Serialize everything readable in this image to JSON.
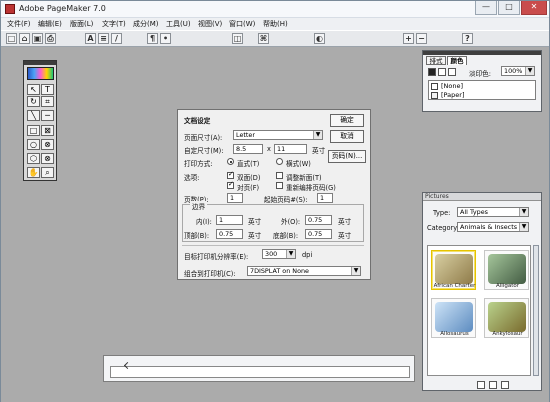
{
  "window": {
    "title": "Adobe PageMaker 7.0",
    "controls": [
      "—",
      "□",
      "✕"
    ]
  },
  "menubar": [
    "文件(F)",
    "编辑(E)",
    "版面(L)",
    "文字(T)",
    "成分(M)",
    "工具(U)",
    "视图(V)",
    "窗口(W)",
    "帮助(H)"
  ],
  "toolbar": {
    "items": [
      "new-document-icon",
      "open-folder-icon",
      "save-icon",
      "print-icon",
      "text-tool-icon",
      "align-left-icon",
      "italic-icon",
      "paragraph-icon",
      "bullet-list-icon",
      "image-frame-icon",
      "link-icon",
      "color-icon",
      "zoom-in-icon",
      "zoom-out-icon",
      "help-icon"
    ]
  },
  "doc_setup": {
    "title": "文档设定",
    "page_size_label": "页面尺寸(A):",
    "page_size_value": "Letter",
    "custom_size_label": "自定尺寸(M):",
    "width_value": "8.5",
    "height_value": "11",
    "times_label": "x",
    "unit_inch_1": "英寸",
    "print_mode_label": "打印方式:",
    "orientation_portrait": "直式(T)",
    "orientation_landscape": "横式(W)",
    "options_label": "选项:",
    "double_sided": "双面(D)",
    "facing_pages": "对页(F)",
    "adjust_spreads": "调整新面(T)",
    "restart_numbering": "重新编排页码(G)",
    "page_count_label": "页数(P):",
    "page_count_value": "1",
    "start_page_label": "起始页码#(S):",
    "start_page_value": "1",
    "margins_label": "边界",
    "inside_label": "内(I):",
    "inside_value": "1",
    "outside_label": "外(O):",
    "outside_value": "0.75",
    "top_label": "顶部(B):",
    "top_value": "0.75",
    "bottom_label": "底部(B):",
    "bottom_value": "0.75",
    "unit_inch_2": "英寸",
    "unit_inch_3": "英寸",
    "unit_inch_4": "英寸",
    "unit_inch_5": "英寸",
    "resolution_label": "目标打印机分辨率(E):",
    "resolution_value": "300",
    "dpi": "dpi",
    "printer_label": "组合到打印机(C):",
    "printer_value": "7DISPLAT on None",
    "ok_button": "确定",
    "cancel_button": "取消",
    "page_numbers_button": "页码(N)..."
  },
  "color_panel": {
    "tab_layout": "排式",
    "tab_colors": "颜色",
    "tint_label": "淡印色:",
    "tint_value": "100%",
    "items": [
      "[None]",
      "[Paper]"
    ]
  },
  "pictures_panel": {
    "title": "Pictures",
    "type_label": "Type:",
    "type_value": "All Types",
    "category_label": "Category:",
    "category_value": "Animals & Insects",
    "items": [
      {
        "name": "African Charter",
        "color_a": "#8f7b49",
        "color_b": "#e0d7b6"
      },
      {
        "name": "Alligator",
        "color_a": "#435c43",
        "color_b": "#a5c69b"
      },
      {
        "name": "Allosaurus",
        "color_a": "#5d8cc0",
        "color_b": "#cde3f7"
      },
      {
        "name": "Ankylosaur",
        "color_a": "#7a6b2d",
        "color_b": "#b9d28c"
      }
    ]
  }
}
